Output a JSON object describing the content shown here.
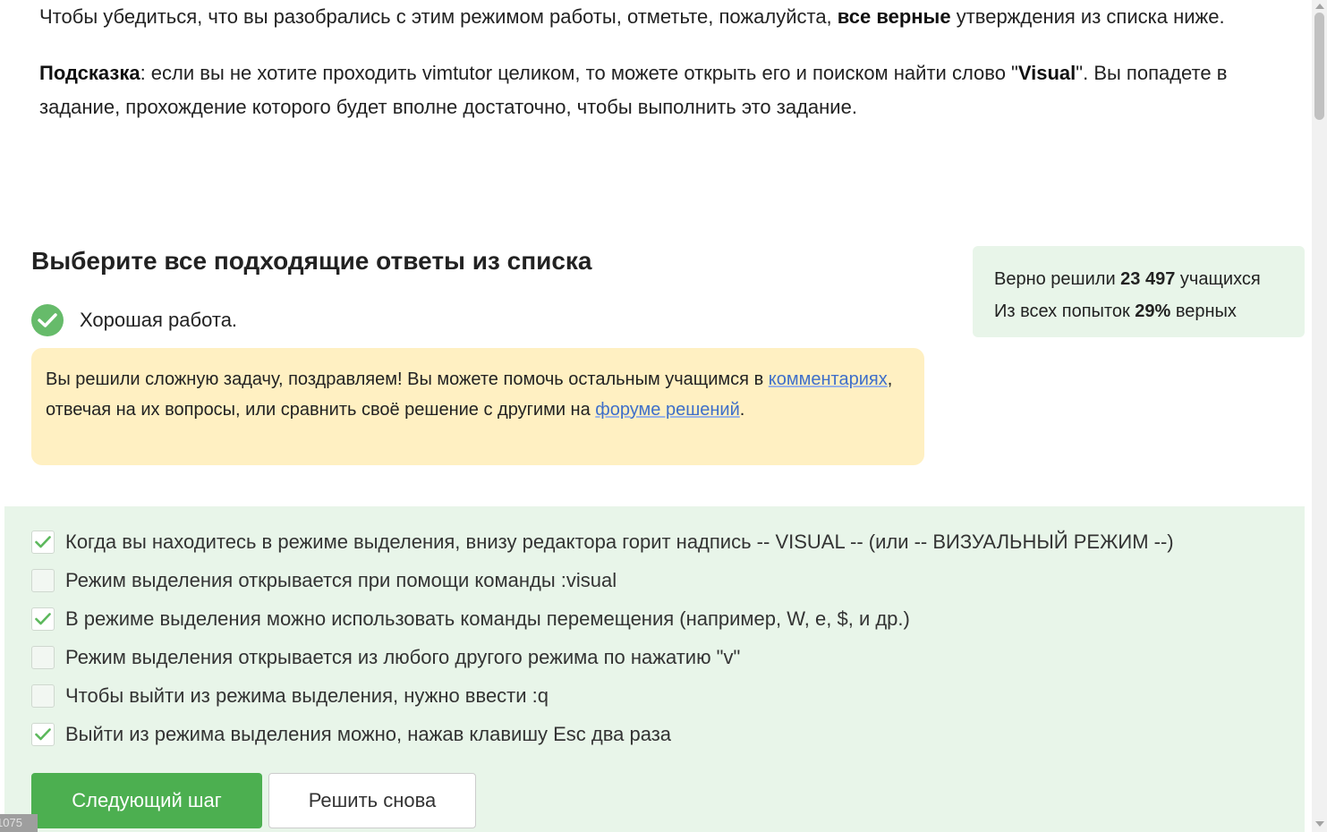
{
  "intro": {
    "p1_start": "Чтобы убедиться, что вы разобрались с этим режимом работы, отметьте, пожалуйста, ",
    "p1_bold": "все верные",
    "p1_end": " утверждения из списка ниже.",
    "p2_label": "Подсказка",
    "p2_mid": ": если вы не хотите проходить vimtutor целиком, то можете открыть его и поиском найти слово \"",
    "p2_word": "Visual",
    "p2_end": "\". Вы попадете в задание, прохождение которого будет вполне достаточно, чтобы выполнить это задание."
  },
  "quiz": {
    "title": "Выберите все подходящие ответы из списка",
    "result_text": "Хорошая работа.",
    "hint": {
      "text_start": "Вы решили сложную задачу, поздравляем! Вы можете помочь остальным учащимся в ",
      "link_comments": "комментариях",
      "text_mid": ", отвечая на их вопросы, или сравнить своё решение с другими на ",
      "link_forum": "форуме решений",
      "text_end": "."
    },
    "options": [
      {
        "label": "Когда вы находитесь в режиме выделения, внизу редактора горит надпись -- VISUAL -- (или -- ВИЗУАЛЬНЫЙ РЕЖИМ --)",
        "checked": true
      },
      {
        "label": "Режим выделения открывается при помощи команды :visual",
        "checked": false
      },
      {
        "label": "В режиме выделения можно использовать команды перемещения (например, W, e, $, и др.)",
        "checked": true
      },
      {
        "label": "Режим выделения открывается из любого другого режима по нажатию \"v\"",
        "checked": false
      },
      {
        "label": "Чтобы выйти из режима выделения, нужно ввести :q",
        "checked": false
      },
      {
        "label": "Выйти из режима выделения можно, нажав клавишу Esc два раза",
        "checked": true
      }
    ],
    "next_button": "Следующий шаг",
    "retry_button": "Решить снова"
  },
  "stats": {
    "line1_prefix": "Верно решили ",
    "solved_count": "23 497",
    "line1_suffix": " учащихся",
    "line2_prefix": "Из всех попыток ",
    "percent": "29%",
    "line2_suffix": " верных"
  },
  "corner_badge": "1075",
  "colors": {
    "success_green": "#4caf50",
    "panel_green": "#e8f5e9",
    "hint_yellow": "#fff0c2",
    "link_blue": "#3f6fc9",
    "check_green": "#5cb85c"
  }
}
